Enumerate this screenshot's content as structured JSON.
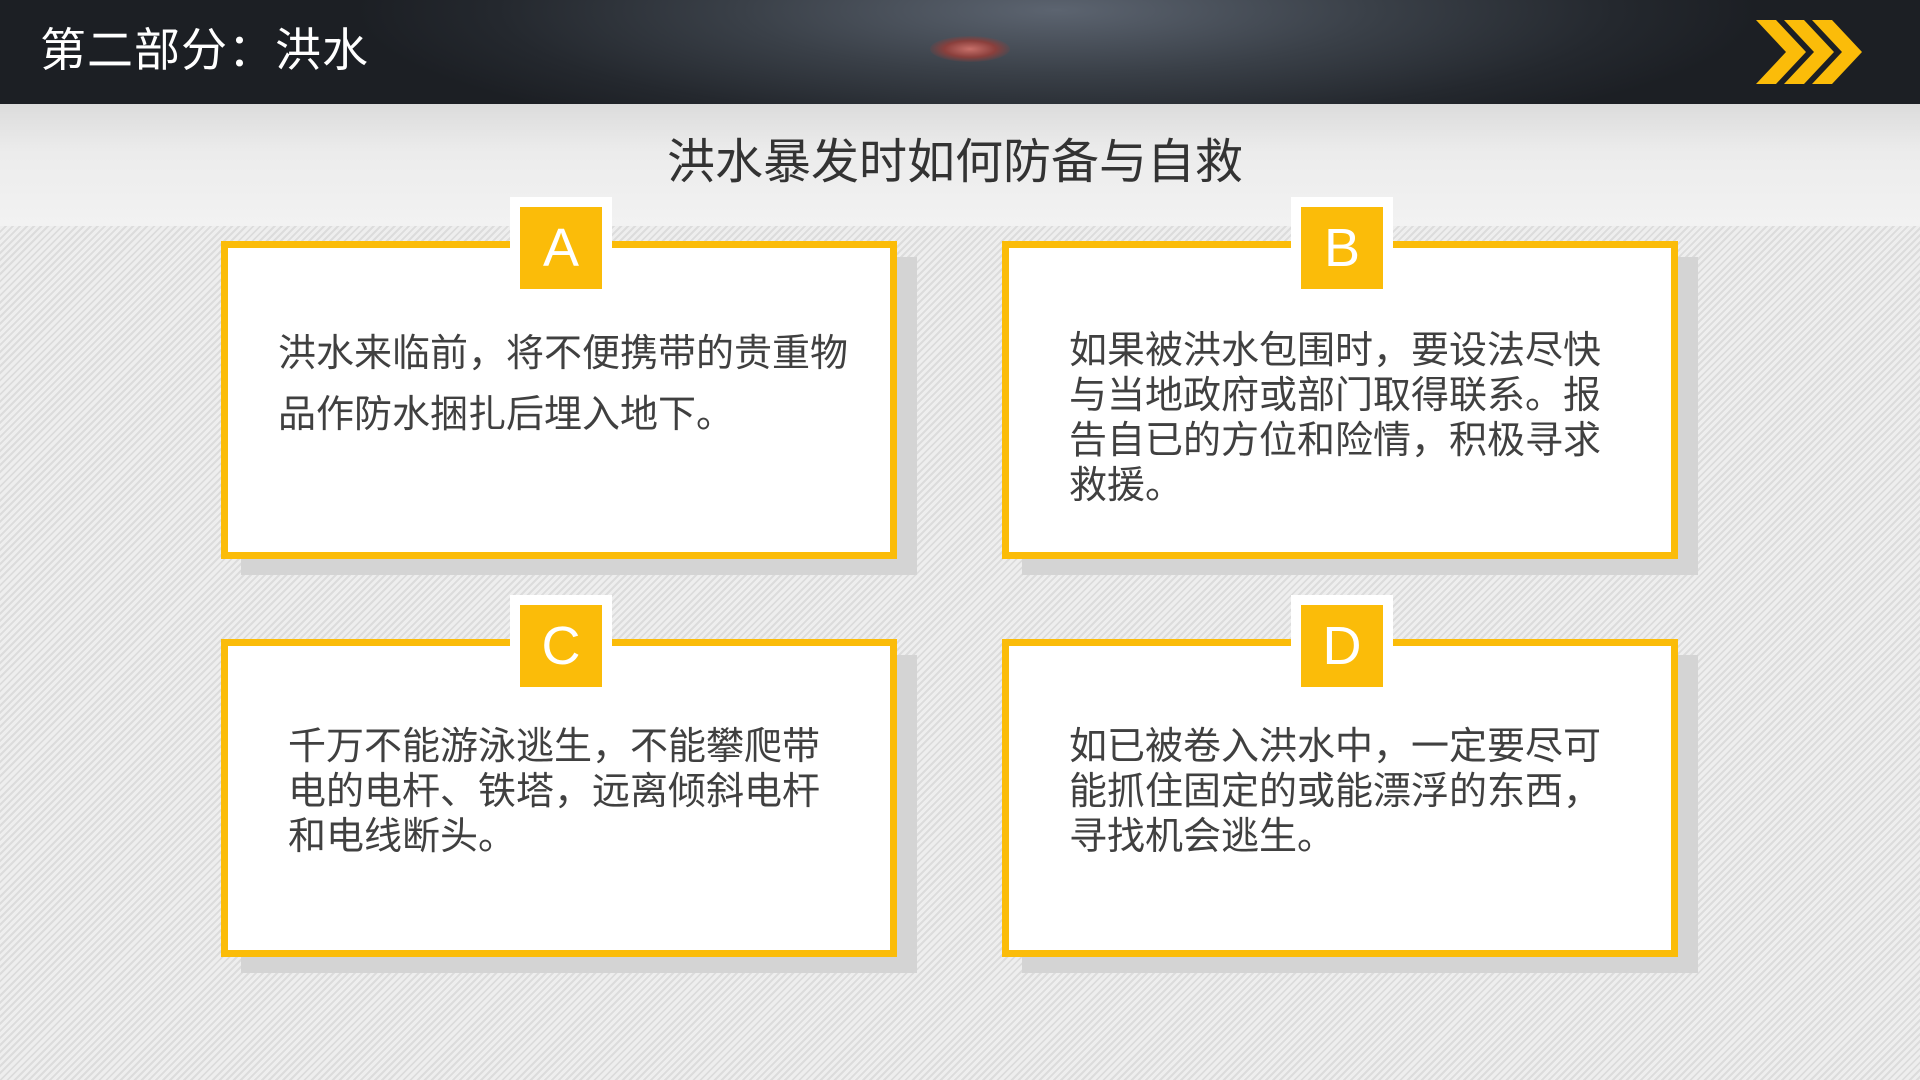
{
  "header": {
    "section_title": "第二部分：洪水",
    "chevron_icon": "triple-chevron-right-icon"
  },
  "main": {
    "title": "洪水暴发时如何防备与自救"
  },
  "cards": [
    {
      "badge": "A",
      "text": "洪水来临前，将不便携带的贵重物品作防水捆扎后埋入地下。"
    },
    {
      "badge": "B",
      "text": "如果被洪水包围时，要设法尽快与当地政府或部门取得联系。报告自已的方位和险情，积极寻求救援。"
    },
    {
      "badge": "C",
      "text": "千万不能游泳逃生，不能攀爬带电的电杆、铁塔，远离倾斜电杆和电线断头。"
    },
    {
      "badge": "D",
      "text": "如已被卷入洪水中，一定要尽可能抓住固定的或能漂浮的东西，寻找机会逃生。"
    }
  ],
  "colors": {
    "accent": "#fbbc09",
    "header_bg": "#2b2f35",
    "text": "#404040"
  }
}
